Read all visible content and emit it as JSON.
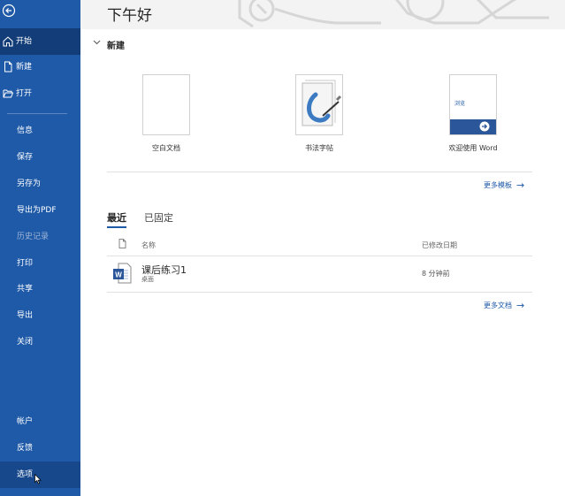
{
  "header": {
    "greeting": "下午好"
  },
  "sidebar": {
    "top_items": [
      {
        "label": "开始",
        "icon": "home-icon"
      },
      {
        "label": "新建",
        "icon": "new-doc-icon"
      },
      {
        "label": "打开",
        "icon": "folder-open-icon"
      }
    ],
    "items": [
      "信息",
      "保存",
      "另存为",
      "导出为PDF",
      "历史记录",
      "打印",
      "共享",
      "导出",
      "关闭"
    ],
    "bottom_items": [
      "帐户",
      "反馈",
      "选项"
    ]
  },
  "new_section": {
    "title": "新建",
    "templates": [
      {
        "name": "空白文档"
      },
      {
        "name": "书法字帖"
      },
      {
        "name": "欢迎使用 Word",
        "thumb_text": "浏览"
      }
    ],
    "more_templates": "更多模板"
  },
  "recent": {
    "tabs": [
      "最近",
      "已固定"
    ],
    "columns": {
      "name": "名称",
      "modified": "已修改日期"
    },
    "files": [
      {
        "name": "课后练习1",
        "location": "桌面",
        "modified": "8 分钟前",
        "icon": "word-doc-icon"
      }
    ],
    "more_documents": "更多文档"
  },
  "colors": {
    "sidebar": "#1f5aa8",
    "sidebar_active": "#133d78",
    "accent": "#1f5aa8"
  }
}
